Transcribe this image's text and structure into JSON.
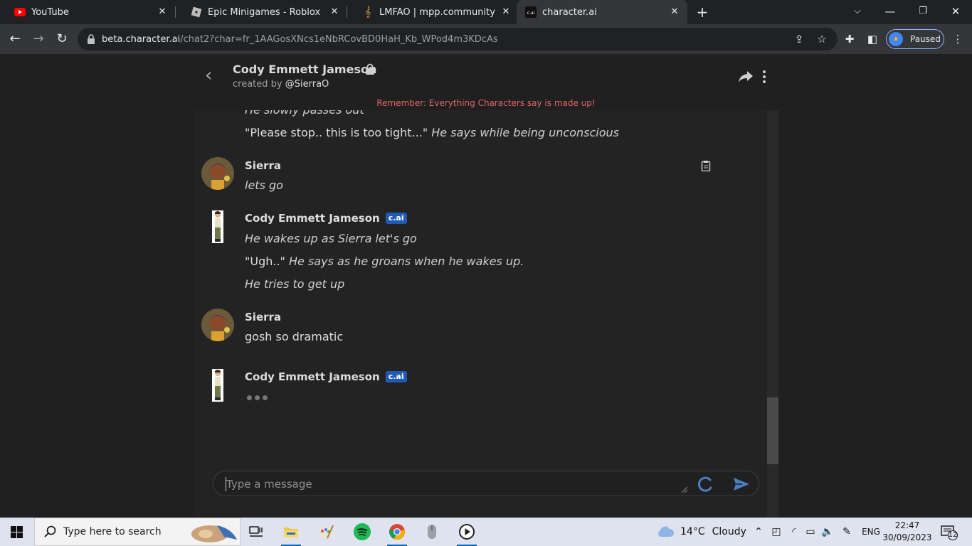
{
  "browser": {
    "tabs": [
      {
        "title": "YouTube",
        "icon": "youtube-icon",
        "active": false
      },
      {
        "title": "Epic Minigames - Roblox",
        "icon": "roblox-icon",
        "active": false
      },
      {
        "title": "LMFAO | mpp.community",
        "icon": "music-note-icon",
        "active": false
      },
      {
        "title": "character.ai",
        "icon": "cai-icon",
        "active": true
      }
    ],
    "url_host": "beta.character.ai",
    "url_path": "/chat2?char=fr_1AAGosXNcs1eNbRCovBD0HaH_Kb_WPod4m3KDcAs",
    "profile_label": "Paused"
  },
  "chat": {
    "character_name": "Cody Emmett Jameson",
    "created_by_prefix": "created by",
    "creator_handle": "@SierraO",
    "disclaimer": "Remember: Everything Characters say is made up!",
    "badge_label": "c.ai",
    "messages": {
      "m0": {
        "cut_line": "He slowly passes out",
        "line_quote": "\"Please stop.. this is too tight...\"",
        "line_action": "He says while being unconscious"
      },
      "m1": {
        "name": "Sierra",
        "text": "lets go"
      },
      "m2": {
        "name": "Cody Emmett Jameson",
        "line1": "He wakes up as Sierra let's go",
        "line2_quote": "\"Ugh..\"",
        "line2_action": "He says as he groans when he wakes up.",
        "line3": "He tries to get up"
      },
      "m3": {
        "name": "Sierra",
        "text": "gosh so dramatic"
      },
      "m4": {
        "name": "Cody Emmett Jameson"
      }
    },
    "input_placeholder": "Type a message"
  },
  "taskbar": {
    "search_placeholder": "Type here to search",
    "weather_temp": "14°C",
    "weather_text": "Cloudy",
    "language": "ENG",
    "time": "22:47",
    "date": "30/09/2023",
    "notification_count": "12"
  },
  "colors": {
    "disclaimer": "#e06666",
    "badge": "#1f5ab4",
    "send": "#4a7fc1"
  }
}
